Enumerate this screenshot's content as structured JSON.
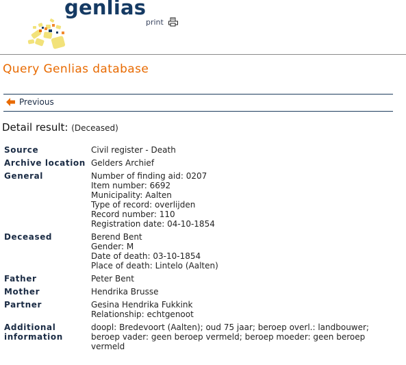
{
  "header": {
    "logo_text": "genlias",
    "print_label": "print"
  },
  "page_title": "Query Genlias database",
  "nav": {
    "previous_label": "Previous"
  },
  "detail": {
    "heading": "Detail result:",
    "subheading": "(Deceased)"
  },
  "rows": {
    "source": {
      "label": "Source",
      "values": [
        "Civil register - Death"
      ]
    },
    "archive": {
      "label": "Archive location",
      "values": [
        "Gelders Archief"
      ]
    },
    "general": {
      "label": "General",
      "values": [
        "Number of finding aid: 0207",
        "Item number: 6692",
        "Municipality: Aalten",
        "Type of record: overlijden",
        "Record number: 110",
        "Registration date: 04-10-1854"
      ]
    },
    "deceased": {
      "label": "Deceased",
      "values": [
        "Berend Bent",
        "Gender: M",
        "Date of death: 03-10-1854",
        "Place of death: Lintelo (Aalten)"
      ]
    },
    "father": {
      "label": "Father",
      "values": [
        "Peter Bent"
      ]
    },
    "mother": {
      "label": "Mother",
      "values": [
        "Hendrika Brusse"
      ]
    },
    "partner": {
      "label": "Partner",
      "values": [
        "Gesina Hendrika Fukkink",
        "Relationship: echtgenoot"
      ]
    },
    "additional": {
      "label_line1": "Additional",
      "label_line2": "information",
      "values": [
        "doopl: Bredevoort (Aalten); oud 75 jaar; beroep overl.: landbouwer; beroep vader: geen beroep vermeld; beroep moeder: geen beroep vermeld"
      ]
    }
  },
  "colors": {
    "title_orange": "#e86a00",
    "navy": "#153a63",
    "logo_yellow": "#f2e27a"
  },
  "icons": [
    "sun-logo-icon",
    "printer-icon",
    "arrow-left-icon"
  ]
}
